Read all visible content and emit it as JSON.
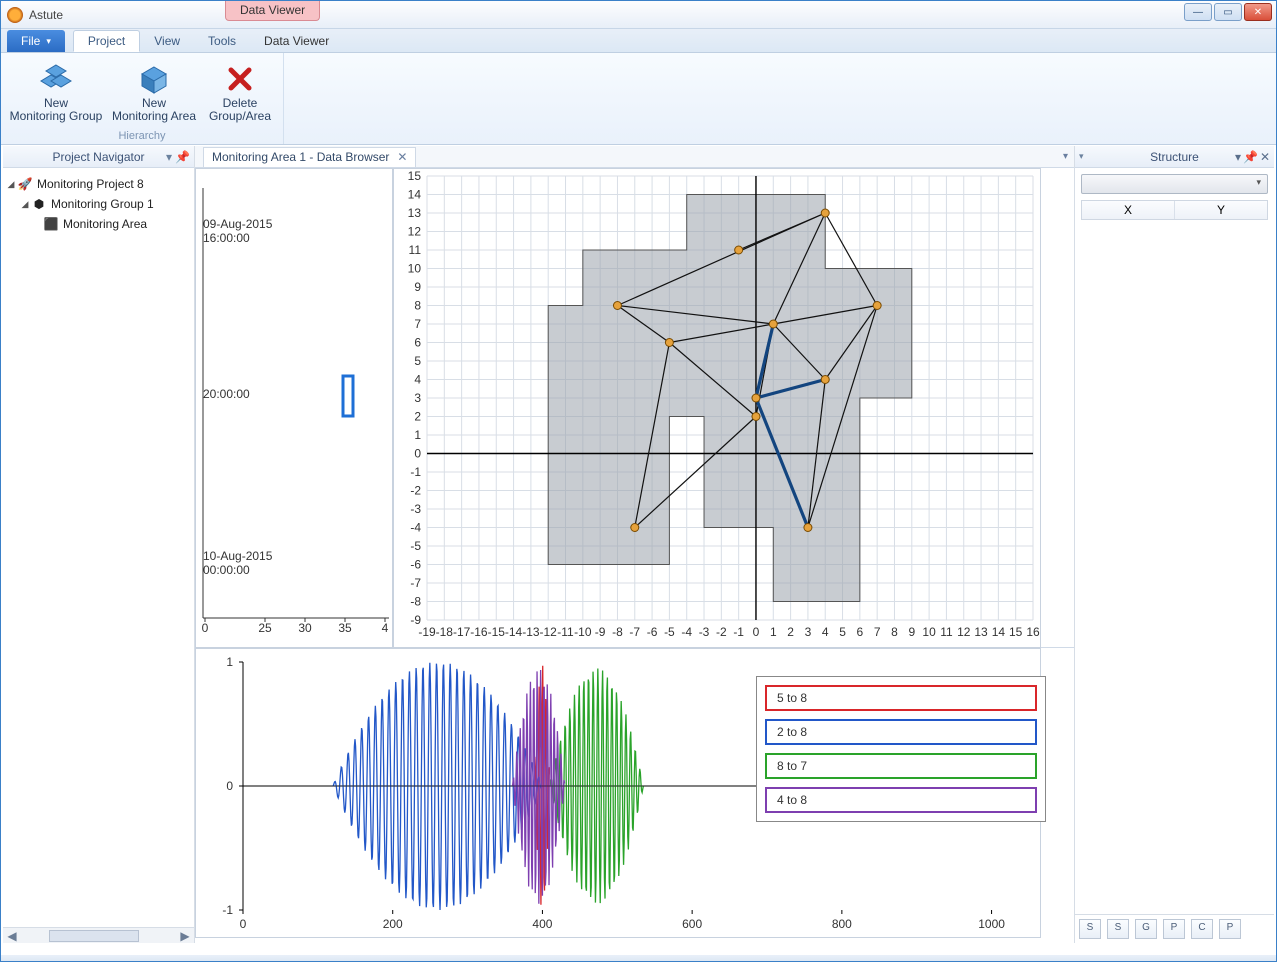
{
  "window": {
    "title": "Astute",
    "context_tab": "Data Viewer"
  },
  "ribbon": {
    "file_label": "File",
    "tabs": [
      "Project",
      "View",
      "Tools",
      "Data Viewer"
    ],
    "active_tab": "Project",
    "group_label": "Hierarchy",
    "buttons": {
      "new_group": "New\nMonitoring Group",
      "new_area": "New\nMonitoring Area",
      "delete": "Delete\nGroup/Area"
    }
  },
  "project_navigator": {
    "title": "Project Navigator",
    "items": [
      {
        "label": "Monitoring Project 8",
        "icon": "rocket",
        "level": 0,
        "expanded": true
      },
      {
        "label": "Monitoring Group 1",
        "icon": "cubes",
        "level": 1,
        "expanded": true
      },
      {
        "label": "Monitoring Area",
        "icon": "cube",
        "level": 2,
        "expanded": false
      }
    ]
  },
  "document": {
    "tab_label": "Monitoring Area 1 - Data Browser"
  },
  "structure_panel": {
    "title": "Structure",
    "columns": [
      "X",
      "Y"
    ]
  },
  "right_mini_tabs": [
    "S",
    "S",
    "G",
    "P",
    "C",
    "P"
  ],
  "chart_data": [
    {
      "type": "timeline",
      "title": "",
      "time_labels": [
        "09-Aug-2015",
        "16:00:00",
        "20:00:00",
        "10-Aug-2015",
        "00:00:00"
      ],
      "x_ticks": [
        0,
        25,
        30,
        35,
        4
      ],
      "marker_x": 35,
      "marker_time": "20:00:00"
    },
    {
      "type": "scatter-network",
      "xlim": [
        -19,
        16
      ],
      "ylim": [
        -9,
        15
      ],
      "x_ticks": [
        -19,
        -18,
        -17,
        -16,
        -15,
        -14,
        -13,
        -12,
        -11,
        -10,
        -9,
        -8,
        -7,
        -6,
        -5,
        -4,
        -3,
        -2,
        -1,
        0,
        1,
        2,
        3,
        4,
        5,
        6,
        7,
        8,
        9,
        10,
        11,
        12,
        13,
        14,
        15,
        16
      ],
      "y_ticks": [
        -9,
        -8,
        -7,
        -6,
        -5,
        -4,
        -3,
        -2,
        -1,
        0,
        1,
        2,
        3,
        4,
        5,
        6,
        7,
        8,
        9,
        10,
        11,
        12,
        13,
        14,
        15
      ],
      "region_polygon": [
        [
          -12,
          -6
        ],
        [
          -12,
          8
        ],
        [
          -10,
          8
        ],
        [
          -10,
          11
        ],
        [
          -4,
          11
        ],
        [
          -4,
          14
        ],
        [
          4,
          14
        ],
        [
          4,
          10
        ],
        [
          9,
          10
        ],
        [
          9,
          3
        ],
        [
          6,
          3
        ],
        [
          6,
          -8
        ],
        [
          1,
          -8
        ],
        [
          1,
          -4
        ],
        [
          -3,
          -4
        ],
        [
          -3,
          2
        ],
        [
          -5,
          2
        ],
        [
          -5,
          -6
        ]
      ],
      "nodes": [
        {
          "id": 1,
          "x": -8,
          "y": 8
        },
        {
          "id": 2,
          "x": -5,
          "y": 6
        },
        {
          "id": 3,
          "x": -1,
          "y": 11
        },
        {
          "id": 4,
          "x": 1,
          "y": 7
        },
        {
          "id": 5,
          "x": 0,
          "y": 3
        },
        {
          "id": 6,
          "x": 0,
          "y": 2
        },
        {
          "id": 7,
          "x": 4,
          "y": 13
        },
        {
          "id": 8,
          "x": 4,
          "y": 4
        },
        {
          "id": 9,
          "x": 7,
          "y": 8
        },
        {
          "id": 10,
          "x": 3,
          "y": -4
        },
        {
          "id": 11,
          "x": -7,
          "y": -4
        }
      ],
      "edges_thin": [
        [
          1,
          2
        ],
        [
          1,
          4
        ],
        [
          1,
          7
        ],
        [
          2,
          4
        ],
        [
          2,
          11
        ],
        [
          2,
          6
        ],
        [
          4,
          7
        ],
        [
          4,
          8
        ],
        [
          4,
          9
        ],
        [
          4,
          6
        ],
        [
          7,
          9
        ],
        [
          8,
          9
        ],
        [
          8,
          10
        ],
        [
          9,
          10
        ],
        [
          3,
          7
        ],
        [
          6,
          11
        ]
      ],
      "edges_thick": [
        [
          5,
          8
        ],
        [
          5,
          4
        ],
        [
          5,
          10
        ]
      ]
    },
    {
      "type": "waveform",
      "xlim": [
        0,
        1050
      ],
      "ylim": [
        -1,
        1
      ],
      "x_ticks": [
        0,
        200,
        400,
        600,
        800,
        1000
      ],
      "y_ticks": [
        -1,
        0,
        1
      ],
      "series": [
        {
          "name": "5 to 8",
          "color": "#d9262a",
          "start": 390,
          "end": 410,
          "peak": 1.0,
          "freq": 0.22
        },
        {
          "name": "2 to 8",
          "color": "#2257c8",
          "start": 120,
          "end": 400,
          "peak": 1.0,
          "freq": 0.11
        },
        {
          "name": "8 to 7",
          "color": "#2aa32a",
          "start": 410,
          "end": 535,
          "peak": 0.95,
          "freq": 0.16
        },
        {
          "name": "4 to 8",
          "color": "#7e3fb0",
          "start": 360,
          "end": 430,
          "peak": 0.95,
          "freq": 0.22
        }
      ]
    }
  ]
}
